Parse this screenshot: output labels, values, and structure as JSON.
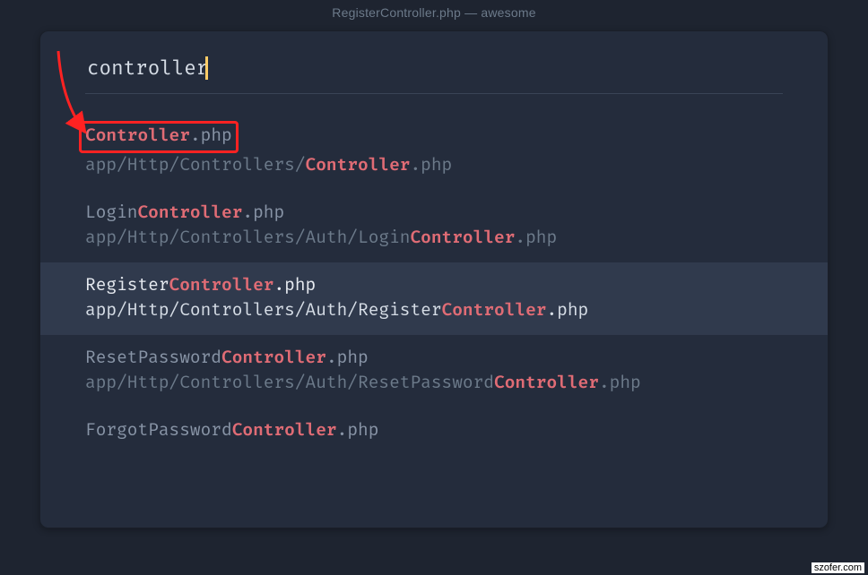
{
  "titlebar": "RegisterController.php — awesome",
  "search": {
    "value": "controller"
  },
  "results": [
    {
      "file_prefix": "",
      "file_match": "Controller",
      "file_suffix": ".php",
      "path_prefix": "app/Http/Controllers/",
      "path_match": "Controller",
      "path_suffix": ".php",
      "selected": false,
      "boxed": true
    },
    {
      "file_prefix": "Login",
      "file_match": "Controller",
      "file_suffix": ".php",
      "path_prefix": "app/Http/Controllers/Auth/Login",
      "path_match": "Controller",
      "path_suffix": ".php",
      "selected": false,
      "boxed": false
    },
    {
      "file_prefix": "Register",
      "file_match": "Controller",
      "file_suffix": ".php",
      "path_prefix": "app/Http/Controllers/Auth/Register",
      "path_match": "Controller",
      "path_suffix": ".php",
      "selected": true,
      "boxed": false
    },
    {
      "file_prefix": "ResetPassword",
      "file_match": "Controller",
      "file_suffix": ".php",
      "path_prefix": "app/Http/Controllers/Auth/ResetPassword",
      "path_match": "Controller",
      "path_suffix": ".php",
      "selected": false,
      "boxed": false
    },
    {
      "file_prefix": "ForgotPassword",
      "file_match": "Controller",
      "file_suffix": ".php",
      "path_prefix": "",
      "path_match": "",
      "path_suffix": "",
      "selected": false,
      "boxed": false
    }
  ],
  "watermark": "szofer.com"
}
